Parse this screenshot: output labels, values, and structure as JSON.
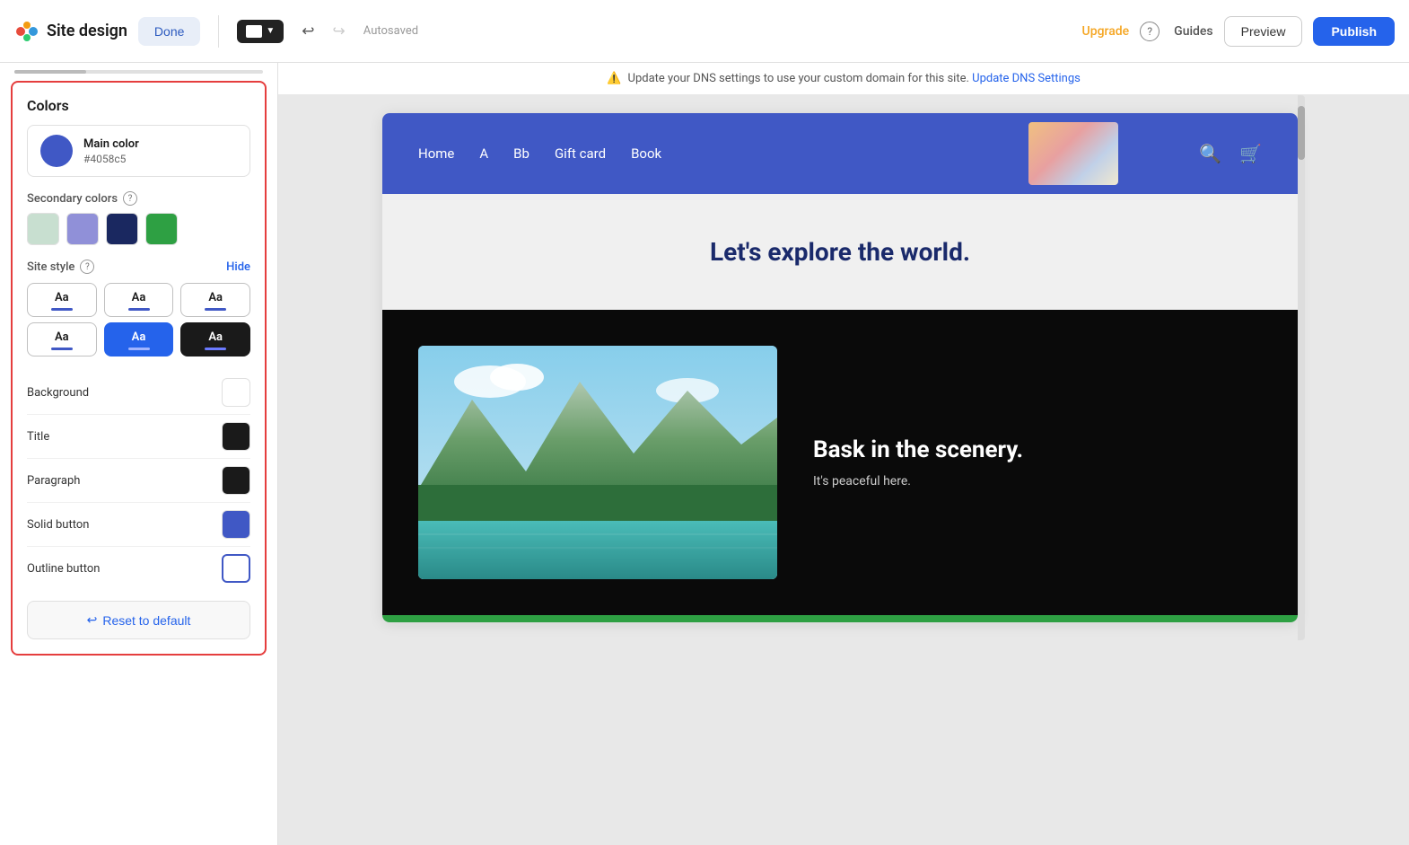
{
  "app": {
    "title": "Site design",
    "done_label": "Done"
  },
  "toolbar": {
    "autosaved": "Autosaved",
    "upgrade_label": "Upgrade",
    "guides_label": "Guides",
    "preview_label": "Preview",
    "publish_label": "Publish",
    "help_icon": "?",
    "undo_icon": "↩",
    "redo_icon": "↪"
  },
  "colors_panel": {
    "title": "Colors",
    "main_color": {
      "label": "Main color",
      "hex": "#4058c5",
      "color": "#4058c5"
    },
    "secondary_colors": {
      "label": "Secondary colors",
      "swatches": [
        {
          "color": "#c8dfd0",
          "id": "swatch-1"
        },
        {
          "color": "#9090d8",
          "id": "swatch-2"
        },
        {
          "color": "#1a2860",
          "id": "swatch-3"
        },
        {
          "color": "#2ea043",
          "id": "swatch-4"
        }
      ]
    },
    "site_style": {
      "label": "Site style",
      "hide_label": "Hide",
      "options": [
        {
          "id": "style-1",
          "text": "Aa",
          "selected": false,
          "dark": false,
          "blue": false
        },
        {
          "id": "style-2",
          "text": "Aa",
          "selected": false,
          "dark": false,
          "blue": false
        },
        {
          "id": "style-3",
          "text": "Aa",
          "selected": false,
          "dark": false,
          "blue": false
        },
        {
          "id": "style-4",
          "text": "Aa",
          "selected": false,
          "dark": false,
          "blue": false
        },
        {
          "id": "style-5",
          "text": "Aa",
          "selected": false,
          "dark": false,
          "blue": true
        },
        {
          "id": "style-6",
          "text": "Aa",
          "selected": false,
          "dark": true,
          "blue": false
        }
      ]
    },
    "color_settings": [
      {
        "label": "Background",
        "type": "white"
      },
      {
        "label": "Title",
        "type": "black"
      },
      {
        "label": "Paragraph",
        "type": "black"
      },
      {
        "label": "Solid button",
        "type": "blue"
      },
      {
        "label": "Outline button",
        "type": "blue"
      }
    ],
    "reset_label": "Reset to default"
  },
  "dns_banner": {
    "message": "Update your DNS settings to use your custom domain for this site.",
    "link_label": "Update DNS Settings"
  },
  "site_preview": {
    "nav_items": [
      "Home",
      "A",
      "Bb",
      "Gift card",
      "Book"
    ],
    "hero_heading": "Let's explore the world.",
    "dark_section": {
      "heading": "Bask in the scenery.",
      "subtext": "It's peaceful here."
    },
    "search_icon": "🔍",
    "cart_icon": "🛒"
  }
}
